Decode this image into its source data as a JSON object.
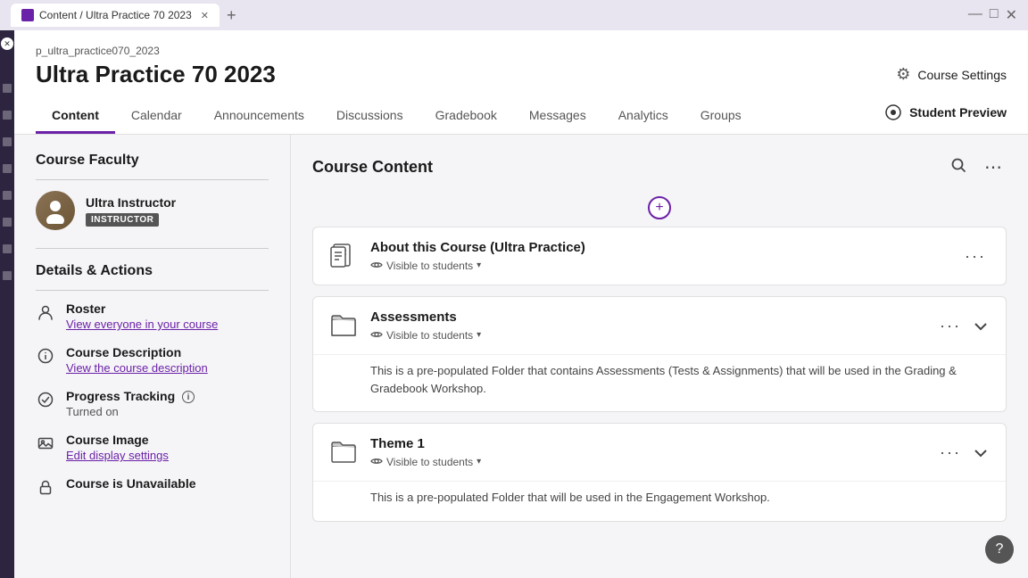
{
  "browser": {
    "tab_label": "Content / Ultra Practice 70 2023",
    "new_tab_symbol": "+",
    "close_symbol": "✕",
    "minimize_symbol": "—",
    "maximize_symbol": "□"
  },
  "course": {
    "id": "p_ultra_practice070_2023",
    "title": "Ultra Practice 70 2023",
    "settings_label": "Course Settings"
  },
  "nav": {
    "tabs": [
      "Content",
      "Calendar",
      "Announcements",
      "Discussions",
      "Gradebook",
      "Messages",
      "Analytics",
      "Groups"
    ],
    "active_tab": "Content",
    "student_preview_label": "Student Preview"
  },
  "left_panel": {
    "faculty_section_title": "Course Faculty",
    "instructor_name": "Ultra Instructor",
    "instructor_badge": "INSTRUCTOR",
    "details_section_title": "Details & Actions",
    "details": [
      {
        "label": "Roster",
        "link": "View everyone in your course",
        "icon": "person"
      },
      {
        "label": "Course Description",
        "link": "View the course description",
        "icon": "info"
      },
      {
        "label": "Progress Tracking",
        "sub": "Turned on",
        "icon": "check-circle",
        "has_info": true
      },
      {
        "label": "Course Image",
        "link": "Edit display settings",
        "icon": "image"
      },
      {
        "label": "Course is Unavailable",
        "icon": "lock"
      }
    ]
  },
  "right_panel": {
    "section_title": "Course Content",
    "items": [
      {
        "id": "about",
        "title": "About this Course (Ultra Practice)",
        "type": "document",
        "visibility": "Visible to students",
        "has_expand": false,
        "body": null
      },
      {
        "id": "assessments",
        "title": "Assessments",
        "type": "folder",
        "visibility": "Visible to students",
        "has_expand": true,
        "body": "This is a pre-populated Folder that contains Assessments (Tests & Assignments) that will be used in the Grading & Gradebook Workshop."
      },
      {
        "id": "theme1",
        "title": "Theme 1",
        "type": "folder",
        "visibility": "Visible to students",
        "has_expand": true,
        "body": "This is a pre-populated Folder that will be used in the Engagement Workshop."
      }
    ],
    "add_symbol": "+"
  },
  "icons": {
    "search": "🔍",
    "more": "⋯",
    "gear": "⚙",
    "student_preview": "👁",
    "eye": "👁",
    "caret_down": "▾",
    "chevron_down": "∨",
    "plus": "+",
    "help": "?"
  }
}
